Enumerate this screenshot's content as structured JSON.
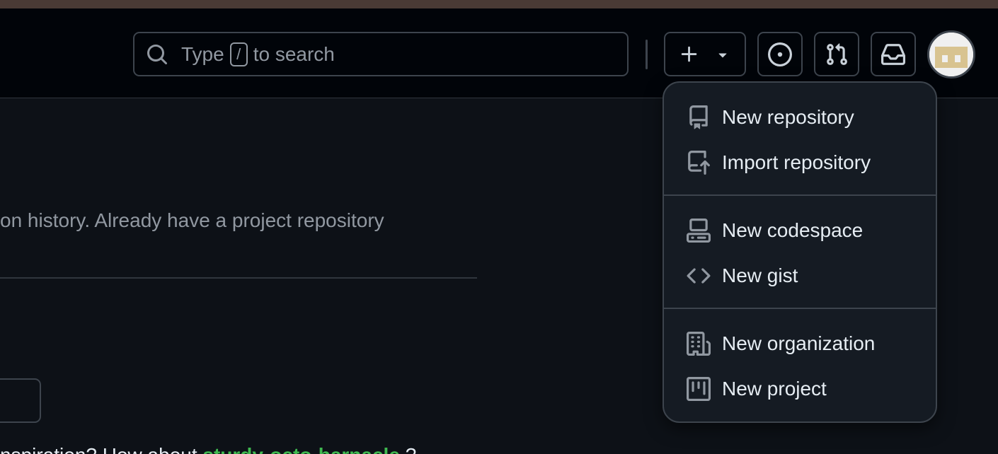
{
  "search": {
    "text_before": "Type",
    "shortcut": "/",
    "text_after": "to search"
  },
  "header_buttons": {
    "create": "+",
    "issues": "issue-opened-icon",
    "pulls": "git-pull-request-icon",
    "inbox": "inbox-icon"
  },
  "main": {
    "description": "on history. Already have a project repository",
    "inspiration_prefix": "nspiration? How about",
    "inspiration_link": "sturdy-octo-barnacle",
    "inspiration_suffix": "?"
  },
  "menu": {
    "items": [
      {
        "label": "New repository",
        "icon": "repo-icon"
      },
      {
        "label": "Import repository",
        "icon": "repo-push-icon"
      },
      {
        "label": "New codespace",
        "icon": "codespaces-icon"
      },
      {
        "label": "New gist",
        "icon": "code-icon"
      },
      {
        "label": "New organization",
        "icon": "organization-icon"
      },
      {
        "label": "New project",
        "icon": "project-icon"
      }
    ]
  },
  "colors": {
    "accent_link": "#3fb950",
    "menu_bg": "#151b23",
    "header_bg": "#010409",
    "page_bg": "#0d1117"
  }
}
